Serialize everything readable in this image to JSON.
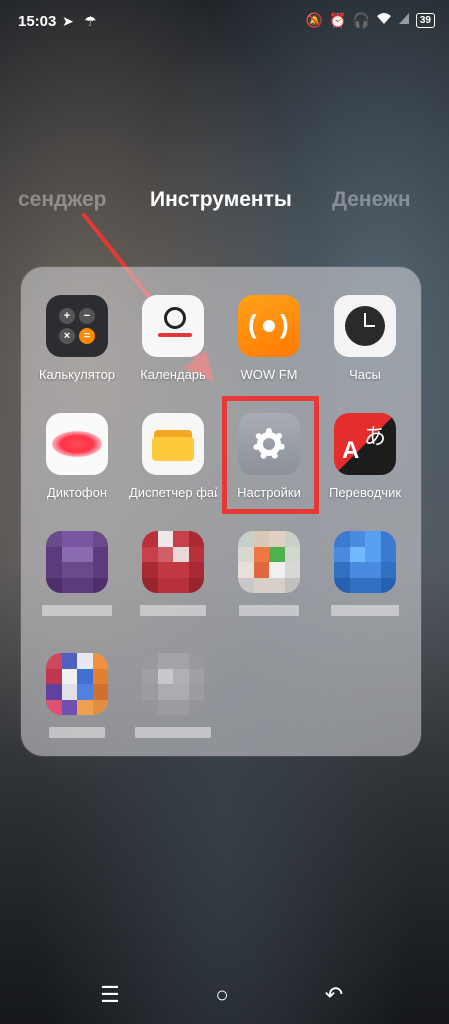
{
  "status_bar": {
    "time": "15:03",
    "left_icons": [
      "telegram-icon",
      "umbrella-icon"
    ],
    "right_icons": [
      "mute-icon",
      "alarm-icon",
      "headphones-icon",
      "wifi-icon",
      "signal-icon"
    ],
    "battery": "39"
  },
  "tabs": {
    "left": "сенджер",
    "center": "Инструменты",
    "right": "Денежн"
  },
  "apps": [
    {
      "label": "Калькулятор",
      "icon": "calculator-icon"
    },
    {
      "label": "Календарь",
      "icon": "calendar-icon"
    },
    {
      "label": "WOW FM",
      "icon": "radio-icon"
    },
    {
      "label": "Часы",
      "icon": "clock-icon"
    },
    {
      "label": "Диктофон",
      "icon": "dictaphone-icon"
    },
    {
      "label": "Диспетчер файлов",
      "icon": "folder-icon"
    },
    {
      "label": "Настройки",
      "icon": "settings-gear-icon"
    },
    {
      "label": "Переводчик",
      "icon": "translator-icon"
    }
  ],
  "highlight_color": "#e53935",
  "nav_bar": {
    "menu": "☰",
    "home": "○",
    "back": "↶"
  }
}
